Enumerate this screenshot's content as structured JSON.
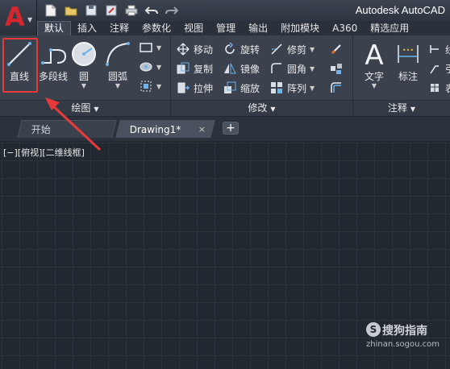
{
  "app": {
    "title": "Autodesk AutoCAD",
    "logo_letter": "A",
    "logo_color": "#d3262e"
  },
  "quick_access": [
    "new-icon",
    "open-icon",
    "save-icon",
    "saveas-icon",
    "print-icon",
    "undo-icon",
    "redo-icon"
  ],
  "ribbon_tabs": [
    {
      "label": "默认",
      "active": true
    },
    {
      "label": "插入"
    },
    {
      "label": "注释"
    },
    {
      "label": "参数化"
    },
    {
      "label": "视图"
    },
    {
      "label": "管理"
    },
    {
      "label": "输出"
    },
    {
      "label": "附加模块"
    },
    {
      "label": "A360"
    },
    {
      "label": "精选应用"
    }
  ],
  "panels": {
    "draw": {
      "title": "绘图",
      "tools": {
        "line": "直线",
        "polyline": "多段线",
        "circle": "圆",
        "arc": "圆弧"
      }
    },
    "modify": {
      "title": "修改",
      "tools": {
        "move": "移动",
        "rotate": "旋转",
        "trim": "修剪",
        "copy": "复制",
        "mirror": "镜像",
        "fillet": "圆角",
        "stretch": "拉伸",
        "scale": "缩放",
        "array": "阵列"
      }
    },
    "annotation": {
      "title": "注释",
      "tools": {
        "text": "文字",
        "dimension": "标注",
        "partial1": "线",
        "partial2": "引",
        "partial3": "表"
      }
    }
  },
  "file_tabs": [
    {
      "label": "开始",
      "active": false
    },
    {
      "label": "Drawing1*",
      "active": true
    }
  ],
  "close_glyph": "×",
  "plus_glyph": "+",
  "viewport_label": "[−][俯视][二维线框]",
  "watermark": {
    "text": "搜狗指南",
    "url": "zhinan.sogou.com",
    "logo": "S"
  },
  "colors": {
    "highlight": "#e83a3a",
    "canvas_bg": "#212830",
    "ribbon_bg": "#3b424e",
    "accent_blue": "#6fb3e8"
  }
}
